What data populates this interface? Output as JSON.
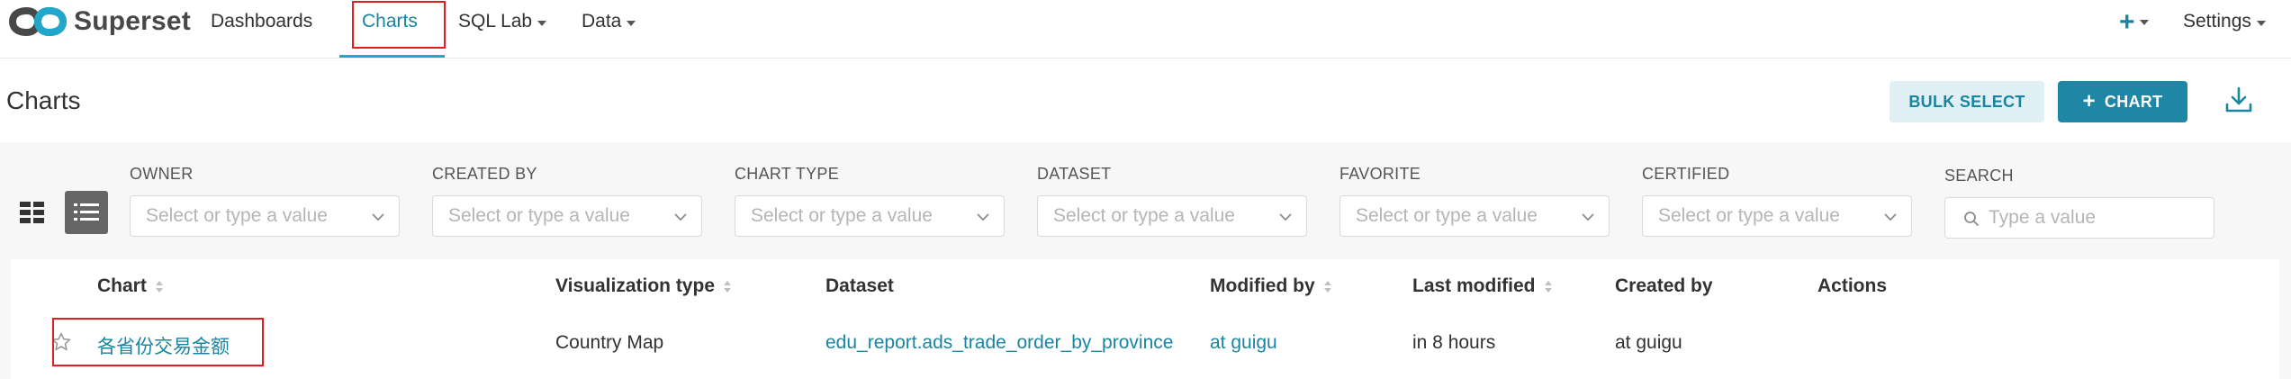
{
  "nav": {
    "brand": "Superset",
    "items": [
      {
        "label": "Dashboards"
      },
      {
        "label": "Charts"
      },
      {
        "label": "SQL Lab"
      },
      {
        "label": "Data"
      }
    ],
    "plus_label": "+",
    "settings_label": "Settings"
  },
  "header": {
    "title": "Charts",
    "bulk_select_label": "BULK SELECT",
    "add_chart_plus": "+",
    "add_chart_label": "CHART"
  },
  "filters": [
    {
      "label": "OWNER",
      "placeholder": "Select or type a value"
    },
    {
      "label": "CREATED BY",
      "placeholder": "Select or type a value"
    },
    {
      "label": "CHART TYPE",
      "placeholder": "Select or type a value"
    },
    {
      "label": "DATASET",
      "placeholder": "Select or type a value"
    },
    {
      "label": "FAVORITE",
      "placeholder": "Select or type a value"
    },
    {
      "label": "CERTIFIED",
      "placeholder": "Select or type a value"
    }
  ],
  "search": {
    "label": "SEARCH",
    "placeholder": "Type a value"
  },
  "table": {
    "columns": [
      "Chart",
      "Visualization type",
      "Dataset",
      "Modified by",
      "Last modified",
      "Created by",
      "Actions"
    ],
    "rows": [
      {
        "chart": "各省份交易金额",
        "viz_type": "Country Map",
        "dataset": "edu_report.ads_trade_order_by_province",
        "modified_by": "at guigu",
        "last_modified": "in 8 hours",
        "created_by": "at guigu",
        "actions": ""
      }
    ]
  },
  "colors": {
    "accent": "#20a7c9",
    "link": "#1a85a0",
    "primary_button": "#1f86a5",
    "highlight_box": "#e21c23"
  }
}
